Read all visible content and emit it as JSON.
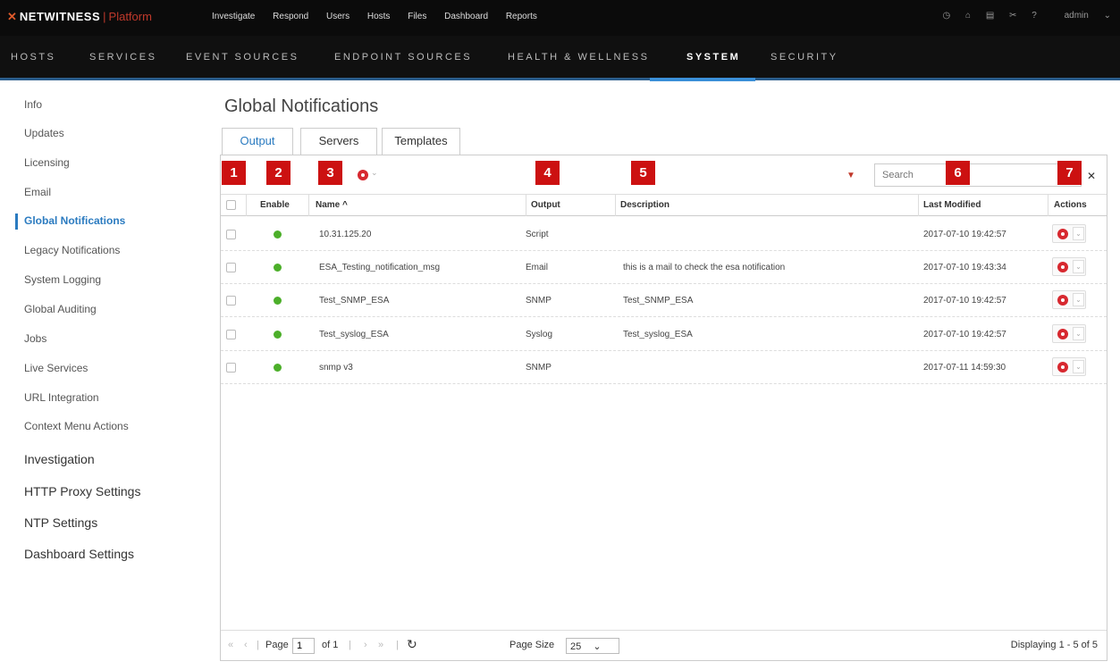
{
  "app": {
    "logo_mark": "✕",
    "brand": "NETWITNESS",
    "separator": "|",
    "product": "Platform"
  },
  "topnav": [
    "Investigate",
    "Respond",
    "Users",
    "Hosts",
    "Files",
    "Dashboard",
    "Reports"
  ],
  "topright": {
    "user": "admin"
  },
  "secnav": [
    "HOSTS",
    "SERVICES",
    "EVENT SOURCES",
    "ENDPOINT SOURCES",
    "HEALTH & WELLNESS",
    "SYSTEM",
    "SECURITY"
  ],
  "sidebar": [
    "Info",
    "Updates",
    "Licensing",
    "Email",
    "Global Notifications",
    "Legacy Notifications",
    "System Logging",
    "Global Auditing",
    "Jobs",
    "Live Services",
    "URL Integration",
    "Context Menu Actions",
    "Investigation",
    "HTTP Proxy Settings",
    "NTP Settings",
    "Dashboard Settings"
  ],
  "page": {
    "title": "Global Notifications"
  },
  "tabs": [
    "Output",
    "Servers",
    "Templates"
  ],
  "badges": [
    "1",
    "2",
    "3",
    "4",
    "5",
    "6",
    "7"
  ],
  "search": {
    "placeholder": "Search",
    "close": "✕"
  },
  "table": {
    "columns": [
      "Enable",
      "Name ^",
      "Output",
      "Description",
      "Last Modified",
      "Actions"
    ],
    "rows": [
      {
        "name": "10.31.125.20",
        "output": "Script",
        "description": "",
        "modified": "2017-07-10 19:42:57",
        "enabled": true
      },
      {
        "name": "ESA_Testing_notification_msg",
        "output": "Email",
        "description": "this is a mail to check the esa notification",
        "modified": "2017-07-10 19:43:34",
        "enabled": true
      },
      {
        "name": "Test_SNMP_ESA",
        "output": "SNMP",
        "description": "Test_SNMP_ESA",
        "modified": "2017-07-10 19:42:57",
        "enabled": true
      },
      {
        "name": "Test_syslog_ESA",
        "output": "Syslog",
        "description": "Test_syslog_ESA",
        "modified": "2017-07-10 19:42:57",
        "enabled": true
      },
      {
        "name": "snmp v3",
        "output": "SNMP",
        "description": "",
        "modified": "2017-07-11 14:59:30",
        "enabled": true
      }
    ]
  },
  "pager": {
    "page_label": "Page",
    "page_value": "1",
    "of_label": "of 1",
    "page_size_label": "Page Size",
    "page_size_value": "25",
    "displaying": "Displaying 1 - 5 of 5"
  },
  "colors": {
    "accent": "#2b7bc0",
    "badge": "#cc1111",
    "gear": "#d7282f",
    "enabled": "#4caf2a"
  }
}
